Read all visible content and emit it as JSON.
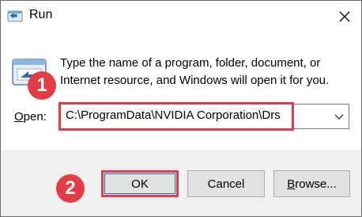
{
  "window": {
    "title": "Run"
  },
  "description": {
    "line1": "Type the name of a program, folder, document, or",
    "line2": "Internet resource, and Windows will open it for you."
  },
  "open": {
    "label_prefix": "O",
    "label_rest": "pen:",
    "value": "C:\\ProgramData\\NVIDIA Corporation\\Drs"
  },
  "buttons": {
    "ok": "OK",
    "cancel": "Cancel",
    "browse_prefix": "B",
    "browse_rest": "rowse..."
  },
  "annotations": {
    "step1": "1",
    "step2": "2"
  },
  "colors": {
    "highlight": "#e43c45",
    "footer_bg": "#f0f0f0",
    "button_bg": "#e1e1e1"
  }
}
